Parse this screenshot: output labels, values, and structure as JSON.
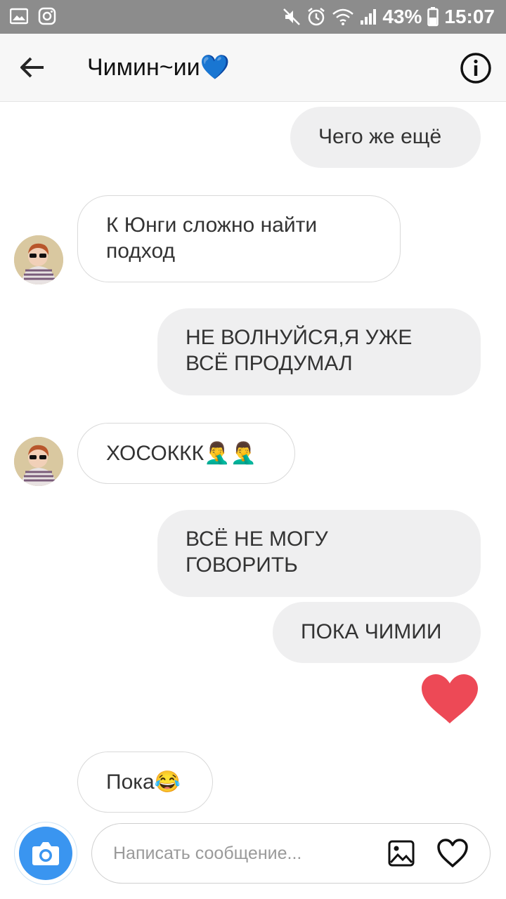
{
  "status_bar": {
    "battery": "43%",
    "time": "15:07"
  },
  "header": {
    "title": "Чимин~ии💙"
  },
  "messages": [
    {
      "text_1": "Чего же ещё"
    },
    {
      "text_1": "К Юнги сложно найти",
      "text_2": "подход"
    },
    {
      "text_1": "НЕ ВОЛНУЙСЯ,Я УЖЕ",
      "text_2": "ВСЁ ПРОДУМАЛ"
    },
    {
      "text_1": "ХОСОККК🤦‍♂️🤦‍♂️"
    },
    {
      "text_1": "ВСЁ НЕ МОГУ",
      "text_2": "ГОВОРИТЬ"
    },
    {
      "text_1": "ПОКА ЧИМИИ"
    },
    {
      "text_1": "Пока😂"
    }
  ],
  "composer": {
    "placeholder": "Написать сообщение..."
  },
  "colors": {
    "accent_blue": "#3a95f0",
    "heart_red": "#ed4956",
    "status_bar": "#8c8c8c"
  },
  "icons": [
    "gallery-icon",
    "instagram-icon",
    "mute-icon",
    "alarm-icon",
    "wifi-icon",
    "signal-icon",
    "battery-icon",
    "back-arrow-icon",
    "info-icon",
    "heart-icon",
    "camera-icon",
    "image-icon",
    "like-icon"
  ]
}
